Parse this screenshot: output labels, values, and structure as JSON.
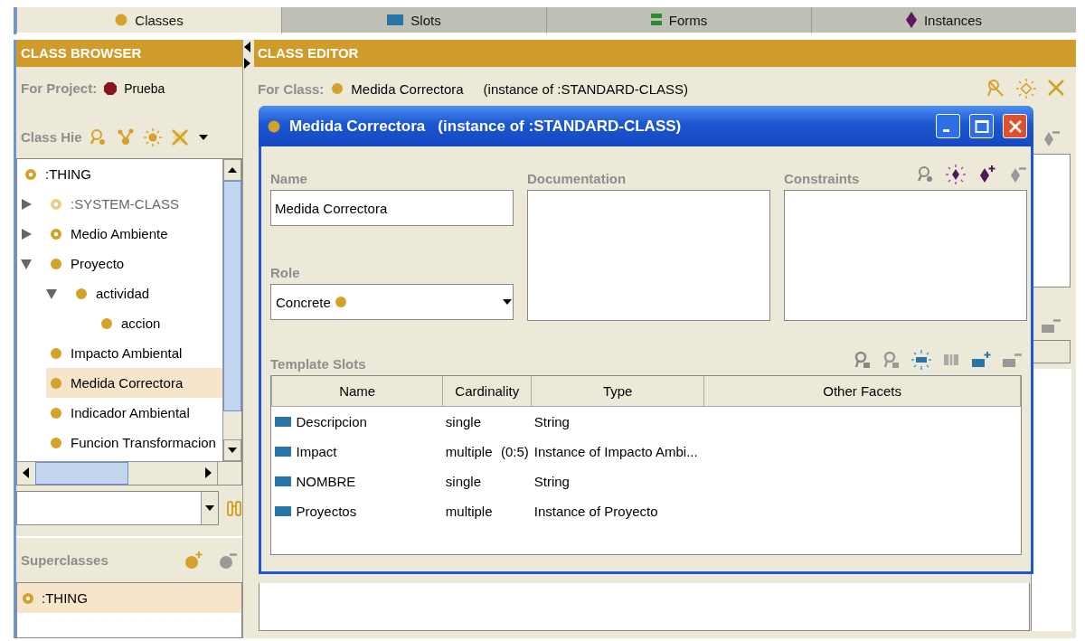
{
  "tabs": [
    {
      "label": "Classes",
      "kind": "class",
      "selected": true
    },
    {
      "label": "Slots",
      "kind": "slot",
      "selected": false
    },
    {
      "label": "Forms",
      "kind": "form",
      "selected": false
    },
    {
      "label": "Instances",
      "kind": "instance",
      "selected": false
    }
  ],
  "class_browser": {
    "title": "CLASS BROWSER",
    "project_label": "For Project:",
    "project": "Prueba",
    "hierarchy_label": "Class Hie",
    "tree": [
      {
        "name": ":THING",
        "kind": "abstract",
        "selected": false,
        "children": [
          {
            "name": ":SYSTEM-CLASS",
            "kind": "system",
            "selected": false,
            "expanded": false
          },
          {
            "name": "Medio Ambiente",
            "kind": "abstract",
            "selected": false,
            "expanded": false
          },
          {
            "name": "Proyecto",
            "kind": "concrete",
            "selected": false,
            "expanded": true,
            "children": [
              {
                "name": "actividad",
                "kind": "concrete",
                "selected": false,
                "expanded": true,
                "children": [
                  {
                    "name": "accion",
                    "kind": "concrete",
                    "selected": false
                  }
                ]
              }
            ]
          },
          {
            "name": "Impacto Ambiental",
            "kind": "concrete",
            "selected": false
          },
          {
            "name": "Medida Correctora",
            "kind": "concrete",
            "selected": true
          },
          {
            "name": "Indicador Ambiental",
            "kind": "concrete",
            "selected": false
          },
          {
            "name": "Funcion Transformacion",
            "kind": "concrete",
            "selected": false
          }
        ]
      }
    ],
    "superclasses_label": "Superclasses",
    "superclasses": [
      {
        "name": ":THING",
        "kind": "abstract",
        "selected": true
      }
    ]
  },
  "class_editor": {
    "title": "CLASS EDITOR",
    "for_class_label": "For Class:",
    "class_name": "Medida Correctora",
    "class_type": "(instance of :STANDARD-CLASS)"
  },
  "dialog": {
    "title": "Medida Correctora",
    "subtitle": "(instance of :STANDARD-CLASS)",
    "name_label": "Name",
    "name_value": "Medida Correctora",
    "documentation_label": "Documentation",
    "constraints_label": "Constraints",
    "role_label": "Role",
    "role_value": "Concrete",
    "template_slots_label": "Template Slots",
    "columns": [
      "Name",
      "Cardinality",
      "Type",
      "Other Facets"
    ],
    "slots": [
      {
        "name": "Descripcion",
        "cardinality": "single",
        "type": "String"
      },
      {
        "name": "Impact",
        "cardinality": "multiple",
        "range": "(0:5)",
        "type": "Instance of Impacto Ambi..."
      },
      {
        "name": "NOMBRE",
        "cardinality": "single",
        "type": "String"
      },
      {
        "name": "Proyectos",
        "cardinality": "multiple",
        "type": "Instance of Proyecto"
      }
    ]
  }
}
